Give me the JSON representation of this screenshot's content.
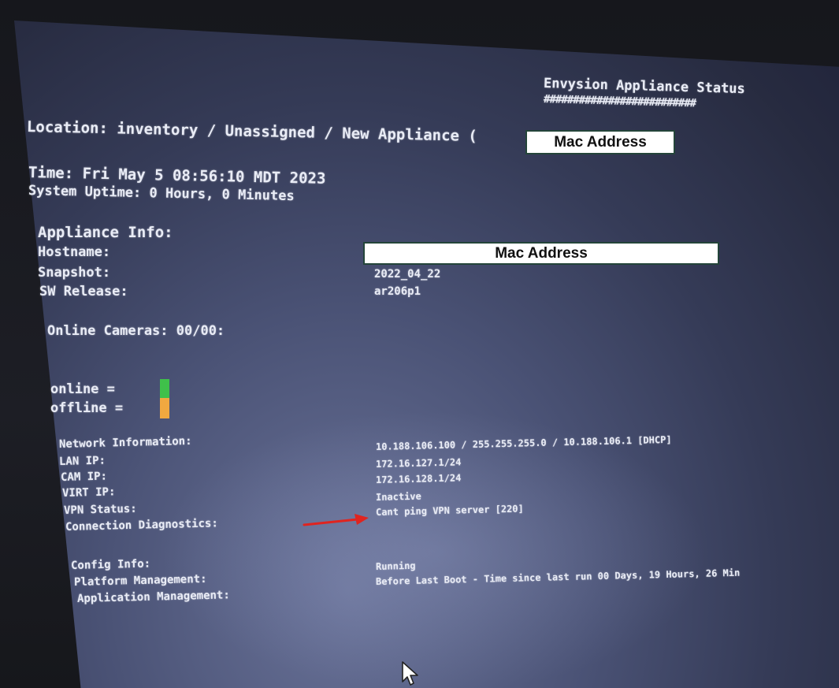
{
  "header": {
    "title": "Envysion Appliance Status",
    "underline": "##########################"
  },
  "location_line": "Location: inventory / Unassigned / New Appliance (",
  "time_line": "Time: Fri May  5 08:56:10 MDT 2023",
  "uptime_line": "System Uptime: 0 Hours, 0 Minutes",
  "appliance_info": {
    "heading": "Appliance Info:",
    "hostname_label": "Hostname:",
    "snapshot_label": "Snapshot:",
    "snapshot_value": "2022_04_22",
    "sw_release_label": "SW Release:",
    "sw_release_value": "ar206p1"
  },
  "cameras_line": "Online Cameras: 00/00:",
  "legend": {
    "online_label": "online  =",
    "offline_label": "offline =",
    "online_color": "#3fc04a",
    "offline_color": "#f0a840"
  },
  "network": {
    "heading": "Network Information:",
    "values": [
      "10.188.106.100 / 255.255.255.0 / 10.188.106.1 [DHCP]",
      "172.16.127.1/24",
      "172.16.128.1/24",
      "Inactive",
      "Cant ping VPN server [220]"
    ],
    "labels": [
      "LAN IP:",
      "CAM IP:",
      "VIRT IP:",
      "VPN Status:",
      "Connection Diagnostics:"
    ]
  },
  "config": {
    "heading": "Config Info:",
    "platform_label": "Platform Management:",
    "application_label": "Application Management:",
    "platform_value": "Running",
    "application_value": "Before Last Boot - Time since last run 00 Days, 19 Hours, 26 Min"
  },
  "redactions": {
    "top_label": "Mac Address",
    "hostname_label": "Mac Address"
  },
  "icons": {
    "arrow": "red-arrow-icon",
    "cursor": "mouse-pointer-icon"
  },
  "colors": {
    "arrow": "#e0241f",
    "screen_text": "#e9ecf6"
  }
}
